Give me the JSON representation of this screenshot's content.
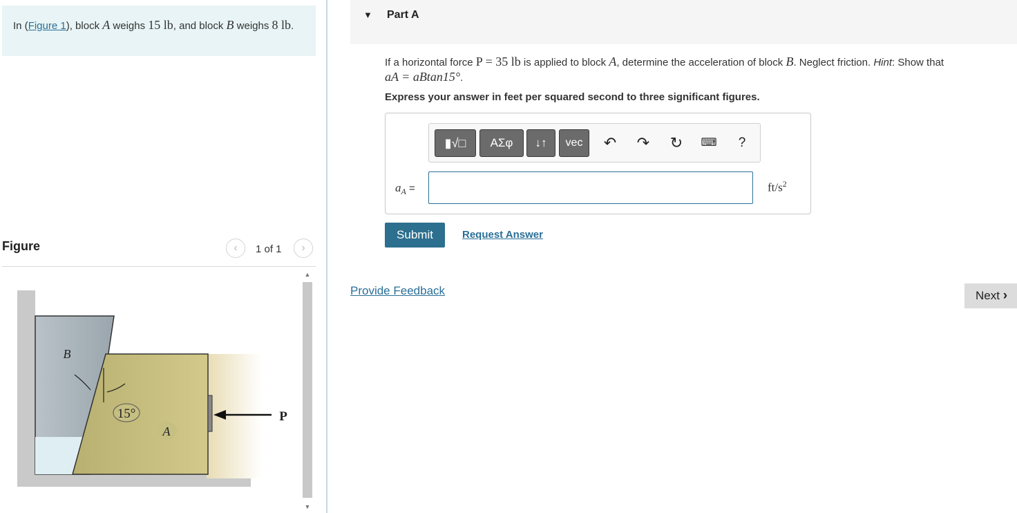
{
  "problem": {
    "prefix": "In (",
    "figure_link": "Figure 1",
    "mid1": "), block ",
    "block_a": "A",
    "mid2": " weighs ",
    "weight_a": "15 lb",
    "mid3": ", and block ",
    "block_b": "B",
    "mid4": " weighs ",
    "weight_b": "8 lb",
    "end": "."
  },
  "figure": {
    "title": "Figure",
    "prev_icon": "chevron-left-icon",
    "next_icon": "chevron-right-icon",
    "count": "1 of 1",
    "labels": {
      "block_b": "B",
      "block_a": "A",
      "angle": "15°",
      "force": "P"
    }
  },
  "part": {
    "title": "Part A",
    "question_1": "If a horizontal force ",
    "force_eq": "P = 35 lb",
    "question_2": " is applied to block ",
    "block": "A",
    "question_3": ", determine the acceleration of block ",
    "block2": "B",
    "question_4": ". Neglect friction. ",
    "hint_label": "Hint",
    "question_5": ": Show that",
    "hint_eq": "aA = aBtan15°",
    "hint_end": ".",
    "instruction": "Express your answer in feet per squared second to three significant figures."
  },
  "toolbar": {
    "templates_icon": "templates-icon",
    "greek": "ΑΣφ",
    "arrows": "↓↑",
    "vec": "vec",
    "undo_icon": "undo-icon",
    "redo_icon": "redo-icon",
    "reset_icon": "reset-icon",
    "keyboard_icon": "keyboard-icon",
    "help": "?"
  },
  "answer": {
    "label_var": "a",
    "label_sub": "A",
    "label_eq": " =",
    "value": "",
    "unit_main": "ft/s",
    "unit_exp": "2"
  },
  "buttons": {
    "submit": "Submit",
    "request": "Request Answer",
    "feedback": "Provide Feedback",
    "next": "Next"
  },
  "colors": {
    "accent": "#2c6f8e",
    "link": "#2a6f97",
    "problem_bg": "#e8f4f5"
  }
}
